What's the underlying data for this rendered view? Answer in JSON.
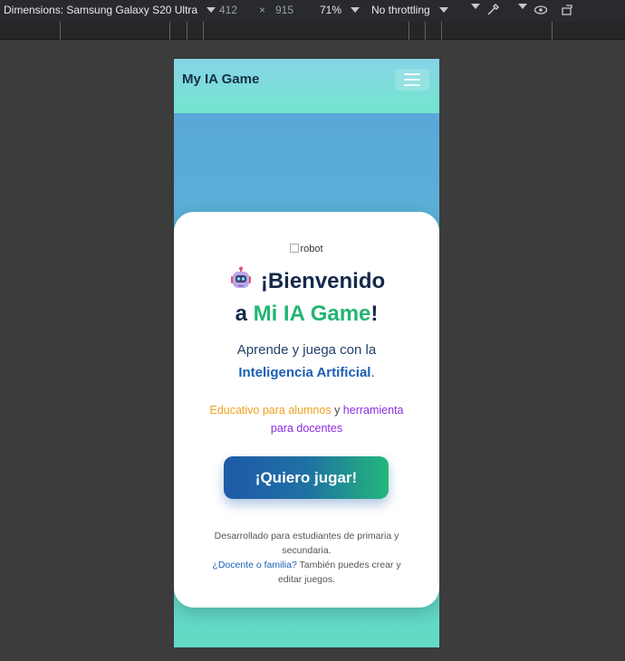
{
  "devtools": {
    "dimensions_label": "Dimensions: Samsung Galaxy S20 Ultra",
    "width_value": "412",
    "times_sign": "×",
    "height_value": "915",
    "zoom": "71%",
    "throttling": "No throttling"
  },
  "app": {
    "brand": "My IA Game",
    "image_alt": "robot",
    "title_line1": "¡Bienvenido",
    "title_line2_pre": "a ",
    "title_line2_accent": "Mi IA Game",
    "title_line2_post": "!",
    "subtitle_pre": "Aprende y juega con la",
    "subtitle_link": "Inteligencia Artificial",
    "subtitle_post": ".",
    "edu_part1": "Educativo para alumnos",
    "edu_part2": " y ",
    "edu_part3": "herramienta",
    "edu_part4": "para docentes",
    "cta_label": "¡Quiero jugar!",
    "footer_line1": "Desarrollado para estudiantes de primaria y secundaria.",
    "footer_link": "¿Docente o familia?",
    "footer_line2": " También puedes crear y editar juegos."
  },
  "colors": {
    "accent_green": "#22b573",
    "title_navy": "#14294b",
    "link_blue": "#1a5fb4",
    "orange": "#f0a020",
    "purple": "#8a2be2"
  },
  "icons": [
    "chevron-down-icon",
    "eyedropper-icon",
    "eye-icon",
    "rotate-device-icon",
    "hamburger-menu-icon",
    "robot-icon"
  ]
}
